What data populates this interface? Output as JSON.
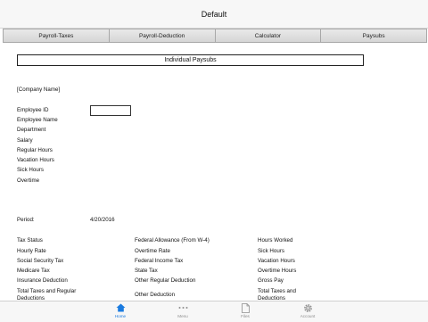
{
  "window": {
    "title": "Default"
  },
  "tabs": [
    "Payroll-Taxes",
    "Payroll-Deduction",
    "Calculator",
    "Paysubs"
  ],
  "section": {
    "title": "Individual Paysubs"
  },
  "company": "[Company Name]",
  "employee_fields": [
    "Employee ID",
    "Employee Name",
    "Department",
    "Salary",
    "Regular Hours",
    "Vacation Hours",
    "Sick Hours",
    "Overtime"
  ],
  "period": {
    "label": "Period:",
    "value": "4/20/2016"
  },
  "grid": {
    "col1": [
      "Tax Status",
      "Hourly Rate",
      "Social Security Tax",
      "Medicare Tax",
      "Insurance Deduction",
      "Total Taxes and Regular",
      "Deductions"
    ],
    "col2": [
      "Federal Allowance (From W-4)",
      "Overtime Rate",
      "Federal Income Tax",
      "State Tax",
      "Other Regular Deduction",
      "Other Deduction"
    ],
    "col3": [
      "Hours Worked",
      "Sick Hours",
      "Vacation Hours",
      "Overtime Hours",
      "Gross Pay",
      "Total Taxes and",
      "Deductions"
    ]
  },
  "bottom_nav": [
    {
      "label": "Home",
      "icon": "home-icon",
      "active": true
    },
    {
      "label": "Menu",
      "icon": "menu-dots-icon",
      "active": false
    },
    {
      "label": "Files",
      "icon": "file-icon",
      "active": false
    },
    {
      "label": "Account",
      "icon": "gear-icon",
      "active": false
    }
  ],
  "colors": {
    "accent": "#1a7be0",
    "inactive": "#8e8e8e"
  }
}
